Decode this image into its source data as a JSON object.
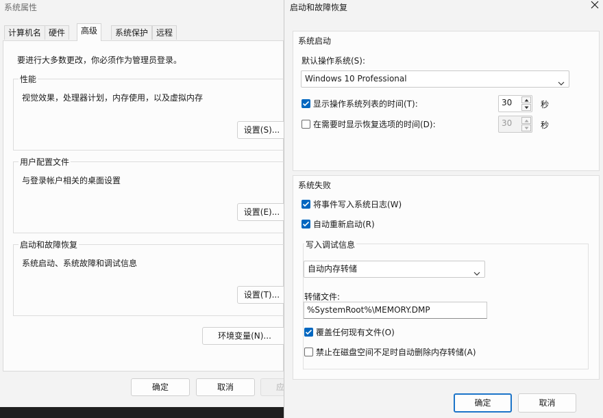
{
  "system_properties": {
    "title": "系统属性",
    "tabs": [
      {
        "label": "计算机名"
      },
      {
        "label": "硬件"
      },
      {
        "label": "高级"
      },
      {
        "label": "系统保护"
      },
      {
        "label": "远程"
      }
    ],
    "admin_notice": "要进行大多数更改，你必须作为管理员登录。",
    "performance": {
      "title": "性能",
      "description": "视觉效果，处理器计划，内存使用，以及虚拟内存",
      "button": "设置(S)..."
    },
    "user_profiles": {
      "title": "用户配置文件",
      "description": "与登录帐户相关的桌面设置",
      "button": "设置(E)..."
    },
    "startup_recovery": {
      "title": "启动和故障恢复",
      "description": "系统启动、系统故障和调试信息",
      "button": "设置(T)..."
    },
    "env_vars_button": "环境变量(N)...",
    "ok_button": "确定",
    "cancel_button": "取消",
    "apply_button": "应"
  },
  "startup_dialog": {
    "title": "启动和故障恢复",
    "system_startup": {
      "title": "系统启动",
      "default_os_label": "默认操作系统(S):",
      "default_os_value": "Windows 10 Professional",
      "show_os_list": {
        "label": "显示操作系统列表的时间(T):",
        "checked": true,
        "value": "30",
        "unit": "秒"
      },
      "show_recovery": {
        "label": "在需要时显示恢复选项的时间(D):",
        "checked": false,
        "value": "30",
        "unit": "秒"
      }
    },
    "system_failure": {
      "title": "系统失败",
      "write_event": {
        "label": "将事件写入系统日志(W)",
        "checked": true
      },
      "auto_restart": {
        "label": "自动重新启动(R)",
        "checked": true
      },
      "debug_info": {
        "title": "写入调试信息",
        "dump_type": "自动内存转储",
        "dump_file_label": "转储文件:",
        "dump_file_value": "%SystemRoot%\\MEMORY.DMP",
        "overwrite": {
          "label": "覆盖任何现有文件(O)",
          "checked": true
        },
        "disable_auto_delete": {
          "label": "禁止在磁盘空间不足时自动删除内存转储(A)",
          "checked": false
        }
      }
    },
    "ok_button": "确定",
    "cancel_button": "取消"
  },
  "colors": {
    "accent": "#0067c0",
    "dialog_bg": "#f3f3f3",
    "panel_bg": "#fcfcfc"
  },
  "icons": {
    "close": "close-icon",
    "dropdown": "chevron-down-icon",
    "check": "checkmark-icon",
    "spin_up": "spin-up-arrow-icon",
    "spin_down": "spin-down-arrow-icon"
  }
}
